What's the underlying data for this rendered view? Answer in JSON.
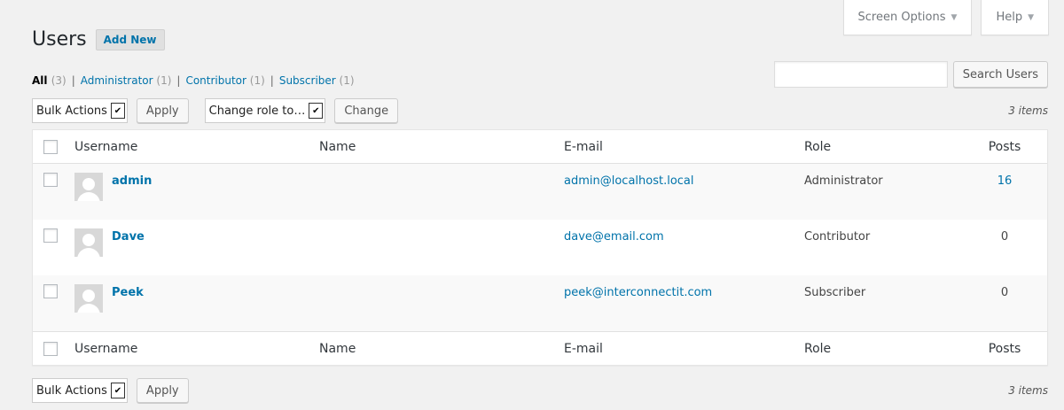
{
  "screen_meta": {
    "screen_options_label": "Screen Options",
    "help_label": "Help",
    "arrow": "▼"
  },
  "header": {
    "title": "Users",
    "add_new_label": "Add New"
  },
  "filters": {
    "all_label": "All",
    "all_count": "(3)",
    "administrator_label": "Administrator",
    "administrator_count": "(1)",
    "contributor_label": "Contributor",
    "contributor_count": "(1)",
    "subscriber_label": "Subscriber",
    "subscriber_count": "(1)",
    "separator": "|"
  },
  "search": {
    "value": "",
    "button_label": "Search Users"
  },
  "tablenav_top": {
    "bulk_actions_selected": "Bulk Actions",
    "apply_label": "Apply",
    "change_role_selected": "Change role to…",
    "change_label": "Change",
    "items_count": "3 items"
  },
  "tablenav_bottom": {
    "bulk_actions_selected": "Bulk Actions",
    "apply_label": "Apply",
    "items_count": "3 items"
  },
  "table": {
    "columns": {
      "username": "Username",
      "name": "Name",
      "email": "E-mail",
      "role": "Role",
      "posts": "Posts"
    },
    "rows": [
      {
        "username": "admin",
        "name": "",
        "email": "admin@localhost.local",
        "role": "Administrator",
        "posts": "16"
      },
      {
        "username": "Dave",
        "name": "",
        "email": "dave@email.com",
        "role": "Contributor",
        "posts": "0"
      },
      {
        "username": "Peek",
        "name": "",
        "email": "peek@interconnectit.com",
        "role": "Subscriber",
        "posts": "0"
      }
    ]
  },
  "icons": {
    "dropdown_arrow": "✔"
  }
}
